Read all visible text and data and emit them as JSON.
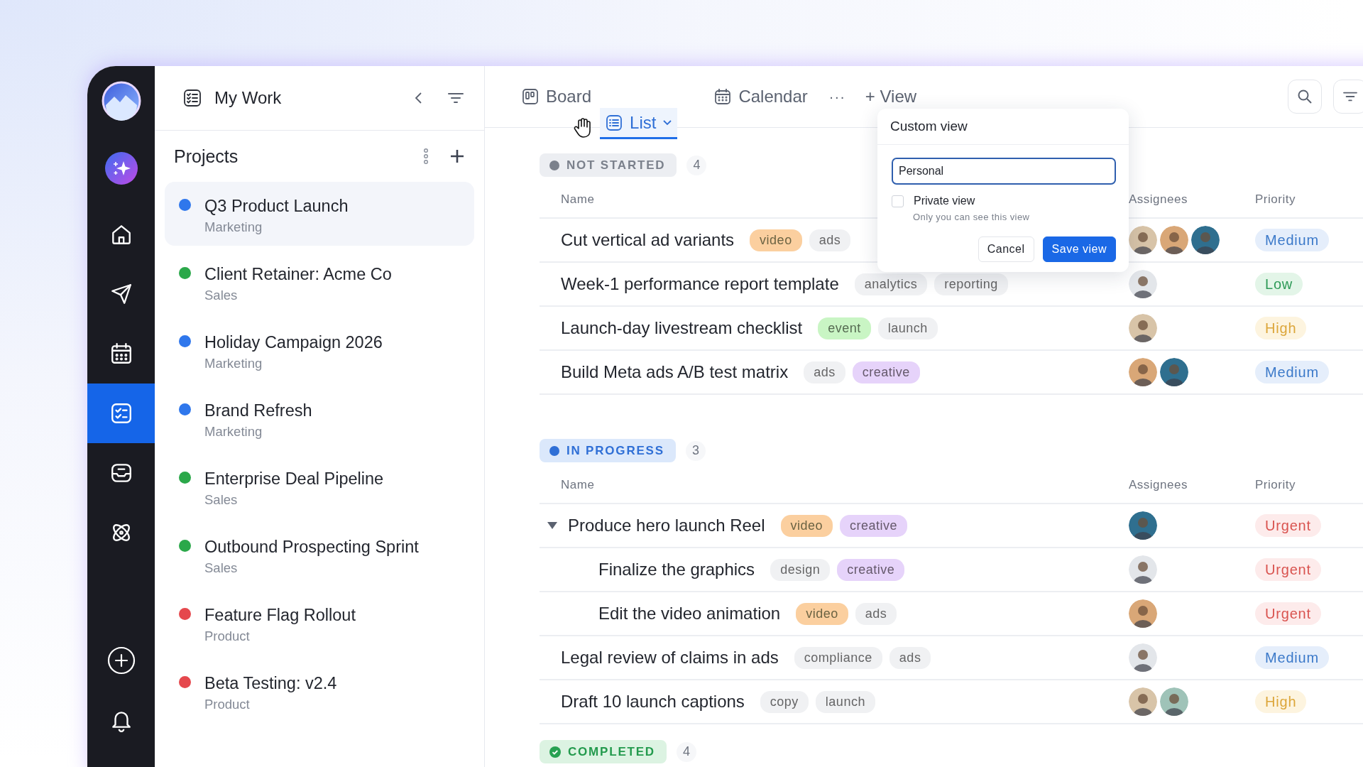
{
  "rail": [
    {
      "selected": false
    },
    {
      "selected": false
    },
    {
      "selected": false
    },
    {
      "selected": true
    },
    {
      "selected": false
    },
    {
      "selected": false
    }
  ],
  "sidebar": {
    "title": "My Work",
    "projects_title": "Projects",
    "projects": [
      {
        "name": "Q3 Product Launch",
        "team": "Marketing",
        "color": "#2f77ec",
        "selected": true
      },
      {
        "name": "Client Retainer: Acme Co",
        "team": "Sales",
        "color": "#2ba84a",
        "selected": false
      },
      {
        "name": "Holiday Campaign 2026",
        "team": "Marketing",
        "color": "#2f77ec",
        "selected": false
      },
      {
        "name": "Brand Refresh",
        "team": "Marketing",
        "color": "#2f77ec",
        "selected": false
      },
      {
        "name": "Enterprise Deal Pipeline",
        "team": "Sales",
        "color": "#2ba84a",
        "selected": false
      },
      {
        "name": "Outbound Prospecting Sprint",
        "team": "Sales",
        "color": "#2ba84a",
        "selected": false
      },
      {
        "name": "Feature Flag Rollout",
        "team": "Product",
        "color": "#e5484d",
        "selected": false
      },
      {
        "name": "Beta Testing: v2.4",
        "team": "Product",
        "color": "#e5484d",
        "selected": false
      }
    ]
  },
  "view_tabs": [
    {
      "label": "Board",
      "selected": false,
      "dragging": false
    },
    {
      "label": "List",
      "selected": true,
      "dragging": true
    },
    {
      "label": "Calendar",
      "selected": false,
      "dragging": false
    }
  ],
  "more_label": "···",
  "add_view_label": "+ View",
  "custom_view": {
    "title": "Custom view",
    "name_value": "Personal",
    "private_label": "Private view",
    "private_checked": false,
    "private_hint": "Only you can see this view",
    "buttons": [
      {
        "label": "Cancel",
        "kind": "secondary"
      },
      {
        "label": "Save view",
        "kind": "primary"
      }
    ]
  },
  "groups": [
    {
      "label": "NOT STARTED",
      "kind": "not_started",
      "count": "4",
      "columns": [
        "Name",
        "Assignees",
        "Priority"
      ],
      "rows": [
        {
          "name": "Cut vertical ad variants",
          "tags": [
            {
              "label": "video",
              "color": "#fbcf9f"
            },
            {
              "label": "ads",
              "color": "#f0f1f3"
            }
          ],
          "assignees": [
            {
              "color": "#d8c4a8"
            },
            {
              "color": "#d9a777"
            },
            {
              "color": "#2f6f8f"
            }
          ],
          "priority": {
            "label": "Medium",
            "kind": "medium"
          }
        },
        {
          "name": "Week-1 performance report template",
          "tags": [
            {
              "label": "analytics",
              "color": "#f0f1f3"
            },
            {
              "label": "reporting",
              "color": "#f0f1f3"
            }
          ],
          "assignees": [
            {
              "color": "#e3e6ea"
            }
          ],
          "priority": {
            "label": "Low",
            "kind": "low"
          }
        },
        {
          "name": "Launch-day livestream checklist",
          "tags": [
            {
              "label": "event",
              "color": "#c9f5c4"
            },
            {
              "label": "launch",
              "color": "#f0f1f3"
            }
          ],
          "assignees": [
            {
              "color": "#d8c4a8"
            }
          ],
          "priority": {
            "label": "High",
            "kind": "high"
          }
        },
        {
          "name": "Build Meta ads A/B test matrix",
          "tags": [
            {
              "label": "ads",
              "color": "#f0f1f3"
            },
            {
              "label": "creative",
              "color": "#e6d3fa"
            }
          ],
          "assignees": [
            {
              "color": "#d9a777"
            },
            {
              "color": "#2f6f8f"
            }
          ],
          "priority": {
            "label": "Medium",
            "kind": "medium"
          }
        }
      ]
    },
    {
      "label": "IN PROGRESS",
      "kind": "in_progress",
      "count": "3",
      "columns": [
        "Name",
        "Assignees",
        "Priority"
      ],
      "rows": [
        {
          "name": "Produce hero launch Reel",
          "tags": [
            {
              "label": "video",
              "color": "#fbcf9f"
            },
            {
              "label": "creative",
              "color": "#e6d3fa"
            }
          ],
          "assignees": [
            {
              "color": "#2f6f8f"
            }
          ],
          "priority": {
            "label": "Urgent",
            "kind": "urgent"
          },
          "expanded": true,
          "children": [
            {
              "name": "Finalize the graphics",
              "tags": [
                {
                  "label": "design",
                  "color": "#f0f1f3"
                },
                {
                  "label": "creative",
                  "color": "#e6d3fa"
                }
              ],
              "assignees": [
                {
                  "color": "#e3e6ea"
                }
              ],
              "priority": {
                "label": "Urgent",
                "kind": "urgent"
              }
            },
            {
              "name": "Edit the video animation",
              "tags": [
                {
                  "label": "video",
                  "color": "#fbcf9f"
                },
                {
                  "label": "ads",
                  "color": "#f0f1f3"
                }
              ],
              "assignees": [
                {
                  "color": "#d9a777"
                }
              ],
              "priority": {
                "label": "Urgent",
                "kind": "urgent"
              }
            }
          ]
        },
        {
          "name": "Legal review of claims in ads",
          "tags": [
            {
              "label": "compliance",
              "color": "#f0f1f3"
            },
            {
              "label": "ads",
              "color": "#f0f1f3"
            }
          ],
          "assignees": [
            {
              "color": "#e3e6ea"
            }
          ],
          "priority": {
            "label": "Medium",
            "kind": "medium"
          }
        },
        {
          "name": "Draft 10 launch captions",
          "tags": [
            {
              "label": "copy",
              "color": "#f0f1f3"
            },
            {
              "label": "launch",
              "color": "#f0f1f3"
            }
          ],
          "assignees": [
            {
              "color": "#d8c4a8"
            },
            {
              "color": "#9fc3b8"
            }
          ],
          "priority": {
            "label": "High",
            "kind": "high"
          }
        }
      ]
    },
    {
      "label": "COMPLETED",
      "kind": "completed",
      "count": "4"
    }
  ]
}
